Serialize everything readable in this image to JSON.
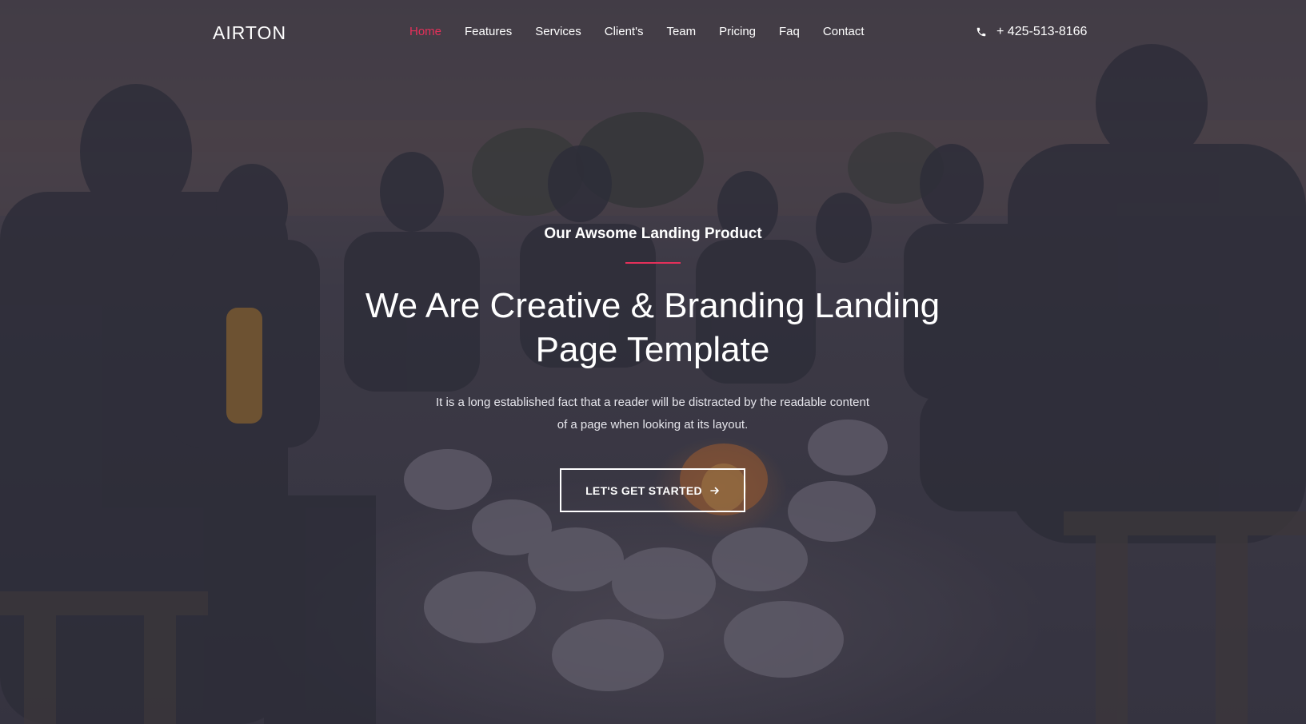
{
  "nav": {
    "logo": "AIRTON",
    "items": [
      {
        "label": "Home",
        "active": true
      },
      {
        "label": "Features"
      },
      {
        "label": "Services"
      },
      {
        "label": "Client's"
      },
      {
        "label": "Team"
      },
      {
        "label": "Pricing"
      },
      {
        "label": "Faq"
      },
      {
        "label": "Contact"
      }
    ],
    "phone": "+ 425-513-8166",
    "phone_icon": "phone-icon"
  },
  "hero": {
    "eyebrow": "Our Awsome Landing Product",
    "headline_line1": "We Are Creative & Branding Landing",
    "headline_line2": "Page Template",
    "description_line1": "It is a long established fact that a reader will be distracted by the readable content",
    "description_line2": "of a page when looking at its layout.",
    "cta_label": "LET'S GET STARTED",
    "cta_icon": "arrow-right-icon"
  },
  "colors": {
    "accent": "#e5305a",
    "overlay": "#2c2b3a"
  }
}
